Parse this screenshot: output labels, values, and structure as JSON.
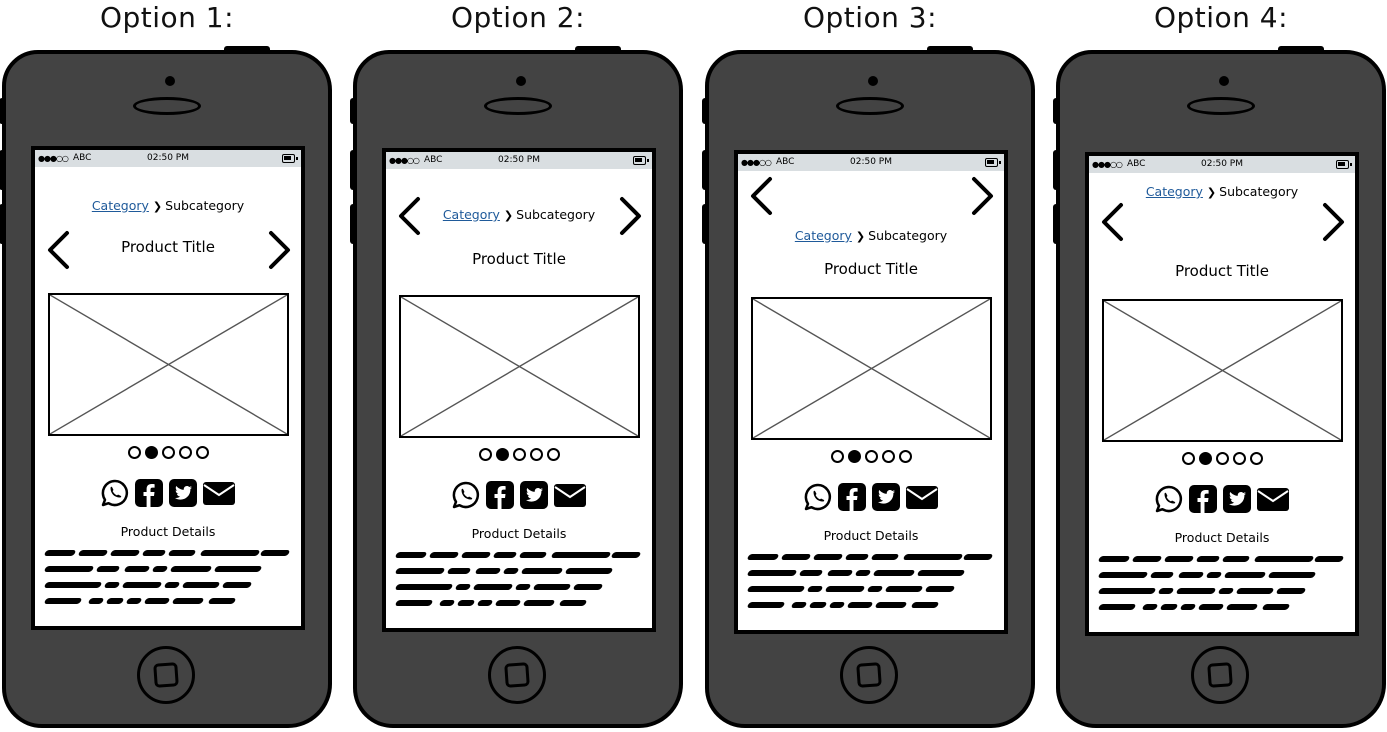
{
  "options": [
    {
      "title": "Option 1:",
      "layout": "breadcrumb-above-title-arrows-beside-title",
      "status_bar": {
        "signal": "●●●○○",
        "carrier": "ABC",
        "time": "02:50 PM",
        "battery": "battery-icon"
      },
      "breadcrumb": {
        "link": "Category",
        "separator": "❯",
        "current": "Subcategory"
      },
      "product_title": "Product Title",
      "prev_icon": "chevron-left-icon",
      "next_icon": "chevron-right-icon",
      "carousel": {
        "total": 5,
        "active_index": 1
      },
      "share_icons": [
        "whatsapp-icon",
        "facebook-icon",
        "twitter-icon",
        "email-icon"
      ],
      "details_label": "Product Details"
    },
    {
      "title": "Option 2:",
      "layout": "arrows-beside-breadcrumb",
      "status_bar": {
        "signal": "●●●○○",
        "carrier": "ABC",
        "time": "02:50 PM",
        "battery": "battery-icon"
      },
      "breadcrumb": {
        "link": "Category",
        "separator": "❯",
        "current": "Subcategory"
      },
      "product_title": "Product Title",
      "prev_icon": "chevron-left-icon",
      "next_icon": "chevron-right-icon",
      "carousel": {
        "total": 5,
        "active_index": 1
      },
      "share_icons": [
        "whatsapp-icon",
        "facebook-icon",
        "twitter-icon",
        "email-icon"
      ],
      "details_label": "Product Details"
    },
    {
      "title": "Option 3:",
      "layout": "arrows-above-breadcrumb",
      "status_bar": {
        "signal": "●●●○○",
        "carrier": "ABC",
        "time": "02:50 PM",
        "battery": "battery-icon"
      },
      "breadcrumb": {
        "link": "Category",
        "separator": "❯",
        "current": "Subcategory"
      },
      "product_title": "Product Title",
      "prev_icon": "chevron-left-icon",
      "next_icon": "chevron-right-icon",
      "carousel": {
        "total": 5,
        "active_index": 1
      },
      "share_icons": [
        "whatsapp-icon",
        "facebook-icon",
        "twitter-icon",
        "email-icon"
      ],
      "details_label": "Product Details"
    },
    {
      "title": "Option 4:",
      "layout": "breadcrumb-top-arrows-between",
      "status_bar": {
        "signal": "●●●○○",
        "carrier": "ABC",
        "time": "02:50 PM",
        "battery": "battery-icon"
      },
      "breadcrumb": {
        "link": "Category",
        "separator": "❯",
        "current": "Subcategory"
      },
      "product_title": "Product Title",
      "prev_icon": "chevron-left-icon",
      "next_icon": "chevron-right-icon",
      "carousel": {
        "total": 5,
        "active_index": 1
      },
      "share_icons": [
        "whatsapp-icon",
        "facebook-icon",
        "twitter-icon",
        "email-icon"
      ],
      "details_label": "Product Details"
    }
  ],
  "product_description": "scribbled placeholder text (4 lines)"
}
